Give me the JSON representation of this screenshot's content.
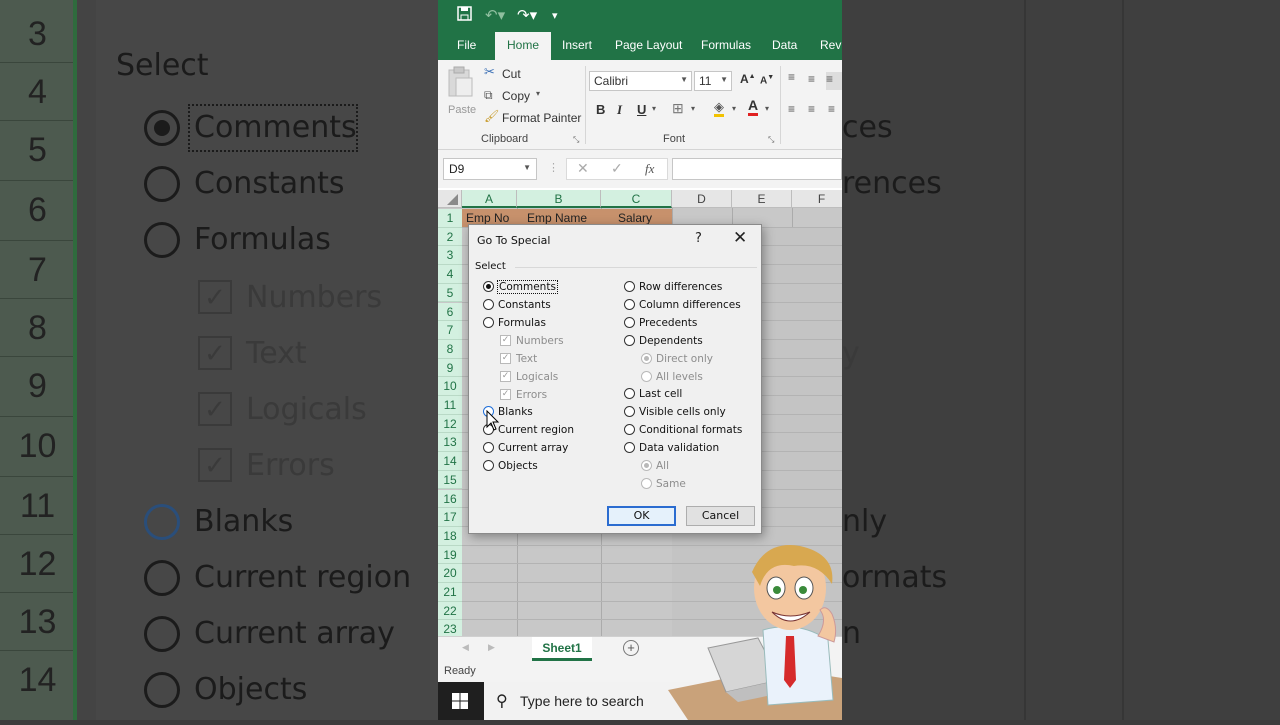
{
  "background": {
    "row_numbers": [
      "3",
      "4",
      "5",
      "6",
      "7",
      "8",
      "9",
      "10",
      "11",
      "12",
      "13",
      "14"
    ],
    "select_label": "Select",
    "left_items": [
      "Comments",
      "Constants",
      "Formulas",
      "Numbers",
      "Text",
      "Logicals",
      "Errors",
      "Blanks",
      "Current region",
      "Current array",
      "Objects"
    ],
    "right_fragments": [
      "ces",
      "rences",
      "y",
      "nly",
      "ormats",
      "n"
    ]
  },
  "excel": {
    "tabs": [
      "File",
      "Home",
      "Insert",
      "Page Layout",
      "Formulas",
      "Data",
      "Revi"
    ],
    "clipboard": {
      "paste": "Paste",
      "cut": "Cut",
      "copy": "Copy",
      "format_painter": "Format Painter",
      "group_label": "Clipboard"
    },
    "font": {
      "name": "Calibri",
      "size": "11",
      "group_label": "Font",
      "bold": "B",
      "italic": "I",
      "underline": "U"
    },
    "name_box": "D9",
    "fx": "fx",
    "columns": [
      "A",
      "B",
      "C",
      "D",
      "E",
      "F"
    ],
    "rows": [
      "1",
      "2",
      "3",
      "4",
      "5",
      "6",
      "7",
      "8",
      "9",
      "10",
      "11",
      "12",
      "13",
      "14",
      "15",
      "16",
      "17",
      "18",
      "19",
      "20",
      "21",
      "22",
      "23"
    ],
    "header_cells": [
      "Emp No",
      "Emp Name",
      "Salary"
    ],
    "sheet_tab": "Sheet1",
    "status": "Ready",
    "search_placeholder": "Type here to search"
  },
  "dialog": {
    "title": "Go To Special",
    "help": "?",
    "close": "✕",
    "group": "Select",
    "left": {
      "comments": "Comments",
      "constants": "Constants",
      "formulas": "Formulas",
      "numbers": "Numbers",
      "text": "Text",
      "logicals": "Logicals",
      "errors": "Errors",
      "blanks": "Blanks",
      "current_region": "Current region",
      "current_array": "Current array",
      "objects": "Objects"
    },
    "right": {
      "row_differences": "Row differences",
      "column_differences": "Column differences",
      "precedents": "Precedents",
      "dependents": "Dependents",
      "direct_only": "Direct only",
      "all_levels": "All levels",
      "last_cell": "Last cell",
      "visible_cells_only": "Visible cells only",
      "conditional_formats": "Conditional formats",
      "data_validation": "Data validation",
      "all": "All",
      "same": "Same"
    },
    "selected": "Comments",
    "ok": "OK",
    "cancel": "Cancel"
  }
}
